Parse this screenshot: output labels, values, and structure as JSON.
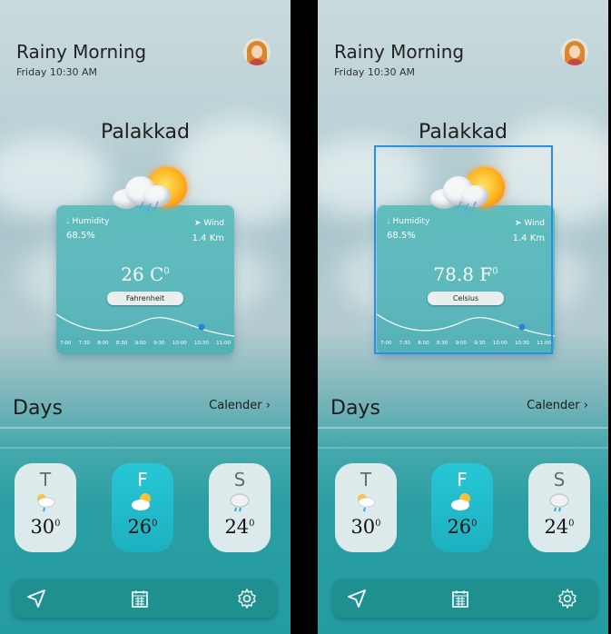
{
  "screens": [
    {
      "header": {
        "title": "Rainy Morning",
        "datetime": "Friday 10:30 AM"
      },
      "city": "Palakkad",
      "weather_card": {
        "humidity_label": "Humidity",
        "humidity_value": "68.5%",
        "wind_label": "Wind",
        "wind_value": "1.4 Km",
        "temperature": "26 C",
        "degree_mark": "0",
        "unit_toggle": "Fahrenheit",
        "hours": [
          "7:00",
          "7:30",
          "8:00",
          "8:30",
          "9:00",
          "9:30",
          "10:00",
          "10:30",
          "11:00"
        ]
      },
      "days_section": {
        "heading": "Days",
        "calendar_link": "Calender"
      },
      "days": [
        {
          "letter": "T",
          "temp": "30",
          "deg": "0",
          "icon": "sun-rain-icon"
        },
        {
          "letter": "F",
          "temp": "26",
          "deg": "0",
          "icon": "partly-sunny-icon"
        },
        {
          "letter": "S",
          "temp": "24",
          "deg": "0",
          "icon": "rain-cloud-icon"
        }
      ],
      "nav": [
        "location-arrow-icon",
        "calendar-icon",
        "settings-gear-icon"
      ]
    },
    {
      "header": {
        "title": "Rainy Morning",
        "datetime": "Friday 10:30 AM"
      },
      "city": "Palakkad",
      "weather_card": {
        "humidity_label": "Humidity",
        "humidity_value": "68.5%",
        "wind_label": "Wind",
        "wind_value": "1.4 Km",
        "temperature": "78.8 F",
        "degree_mark": "0",
        "unit_toggle": "Celsius",
        "hours": [
          "7:00",
          "7:30",
          "8:00",
          "8:30",
          "9:00",
          "9:30",
          "10:00",
          "10:30",
          "11:00"
        ]
      },
      "days_section": {
        "heading": "Days",
        "calendar_link": "Calender"
      },
      "days": [
        {
          "letter": "T",
          "temp": "30",
          "deg": "0",
          "icon": "sun-rain-icon"
        },
        {
          "letter": "F",
          "temp": "26",
          "deg": "0",
          "icon": "partly-sunny-icon"
        },
        {
          "letter": "S",
          "temp": "24",
          "deg": "0",
          "icon": "rain-cloud-icon"
        }
      ],
      "nav": [
        "location-arrow-icon",
        "calendar-icon",
        "settings-gear-icon"
      ]
    }
  ],
  "colors": {
    "accent": "#1fb9c8",
    "nav_bar": "#1d908f",
    "selection": "#2b8ee6"
  }
}
